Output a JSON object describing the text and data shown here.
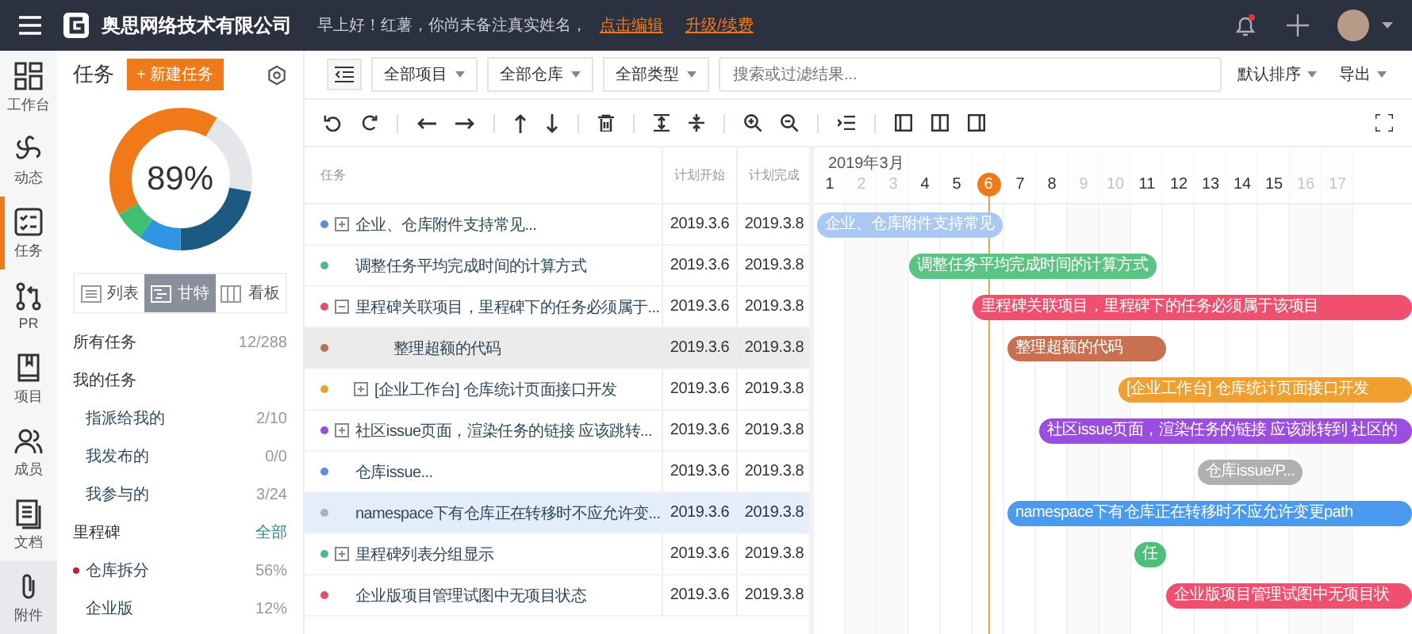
{
  "topbar": {
    "company": "奥思网络技术有限公司",
    "greeting": "早上好！红薯，你尚未备注真实姓名，",
    "edit_link": "点击编辑",
    "upgrade_link": "升级/续费",
    "has_notification": true
  },
  "rail": [
    {
      "label": "工作台",
      "selected": false
    },
    {
      "label": "动态",
      "selected": false
    },
    {
      "label": "任务",
      "selected": true
    },
    {
      "label": "PR",
      "selected": false
    },
    {
      "label": "项目",
      "selected": false
    },
    {
      "label": "成员",
      "selected": false
    },
    {
      "label": "文档",
      "selected": false
    },
    {
      "label": "附件",
      "selected": false
    }
  ],
  "sidebar": {
    "title": "任务",
    "new_button": "+ 新建任务",
    "progress": "89%",
    "views": [
      {
        "label": "列表",
        "selected": false
      },
      {
        "label": "甘特",
        "selected": true
      },
      {
        "label": "看板",
        "selected": false
      }
    ],
    "items": [
      {
        "kind": "row",
        "label": "所有任务",
        "count": "12/288"
      },
      {
        "kind": "header",
        "label": "我的任务"
      },
      {
        "kind": "sub",
        "label": "指派给我的",
        "count": "2/10"
      },
      {
        "kind": "sub",
        "label": "我发布的",
        "count": "0/0"
      },
      {
        "kind": "sub",
        "label": "我参与的",
        "count": "3/24"
      },
      {
        "kind": "header",
        "label": "里程碑",
        "link": "全部"
      },
      {
        "kind": "sub",
        "label": "仓库拆分",
        "count": "56%",
        "color": "#c0203a"
      },
      {
        "kind": "sub",
        "label": "企业版",
        "count": "12%"
      }
    ]
  },
  "filters": [
    "全部项目",
    "全部仓库",
    "全部类型"
  ],
  "search": {
    "placeholder": "搜索或过滤结果..."
  },
  "sort": "默认排序",
  "export": "导出",
  "table": {
    "columns": [
      "任务",
      "计划开始",
      "计划完成"
    ],
    "rows": [
      {
        "kind": "group",
        "expanded": false,
        "name": "企业、仓库附件支持常见...",
        "start": "2019.3.6",
        "end": "2019.3.8",
        "color": "#5b8fd6",
        "selected": false,
        "hovered": false
      },
      {
        "kind": "task",
        "name": "调整任务平均完成时间的计算方式",
        "start": "2019.3.6",
        "end": "2019.3.8",
        "color": "#4fb889",
        "selected": false,
        "hovered": false
      },
      {
        "kind": "group",
        "expanded": true,
        "name": "里程碑关联项目，里程碑下的任务必须属于...",
        "start": "2019.3.6",
        "end": "2019.3.8",
        "color": "#e0506a",
        "selected": false,
        "hovered": false,
        "children": [
          {
            "kind": "task",
            "name": "整理超额的代码",
            "start": "2019.3.6",
            "end": "2019.3.8",
            "color": "#b86f5a",
            "selected": true,
            "hovered": false
          },
          {
            "kind": "group",
            "expanded": false,
            "name": "[企业工作台] 仓库统计页面接口开发",
            "start": "2019.3.6",
            "end": "2019.3.8",
            "color": "#e0a830",
            "selected": false,
            "hovered": false
          }
        ]
      },
      {
        "kind": "group",
        "expanded": false,
        "name": "社区issue页面，渲染任务的链接 应该跳转...",
        "start": "2019.3.6",
        "end": "2019.3.8",
        "color": "#9b4de0",
        "selected": false,
        "hovered": false
      },
      {
        "kind": "task",
        "name": "仓库issue...",
        "start": "2019.3.6",
        "end": "2019.3.8",
        "color": "#5b8fd6",
        "selected": false,
        "hovered": false
      },
      {
        "kind": "task",
        "name": "namespace下有仓库正在转移时不应允许变...",
        "start": "2019.3.6",
        "end": "2019.3.8",
        "color": "#b0b0b0",
        "selected": false,
        "hovered": true
      },
      {
        "kind": "group",
        "expanded": false,
        "name": "里程碑列表分组显示",
        "start": "2019.3.6",
        "end": "2019.3.8",
        "color": "#4fb889",
        "selected": false,
        "hovered": false
      },
      {
        "kind": "task",
        "name": "企业版项目管理试图中无项目状态",
        "start": "2019.3.6",
        "end": "2019.3.8",
        "color": "#e0506a",
        "selected": false,
        "hovered": false
      }
    ]
  },
  "gantt": {
    "month": "2019年3月",
    "days": [
      {
        "label": "1",
        "weekend": false,
        "today": false
      },
      {
        "label": "2",
        "weekend": true,
        "today": false
      },
      {
        "label": "3",
        "weekend": true,
        "today": false
      },
      {
        "label": "4",
        "weekend": false,
        "today": false
      },
      {
        "label": "5",
        "weekend": false,
        "today": false
      },
      {
        "label": "6",
        "weekend": false,
        "today": true
      },
      {
        "label": "7",
        "weekend": false,
        "today": false
      },
      {
        "label": "8",
        "weekend": false,
        "today": false
      },
      {
        "label": "9",
        "weekend": true,
        "today": false
      },
      {
        "label": "10",
        "weekend": true,
        "today": false
      },
      {
        "label": "11",
        "weekend": false,
        "today": false
      },
      {
        "label": "12",
        "weekend": false,
        "today": false
      },
      {
        "label": "13",
        "weekend": false,
        "today": false
      },
      {
        "label": "14",
        "weekend": false,
        "today": false
      },
      {
        "label": "15",
        "weekend": false,
        "today": false
      },
      {
        "label": "16",
        "weekend": true,
        "today": false
      },
      {
        "label": "17",
        "weekend": true,
        "today": false
      }
    ],
    "bars": [
      {
        "label": "企业、仓库附件支持常见",
        "color": "#a9c9f2"
      },
      {
        "label": "调整任务平均完成时间的计算方式",
        "color": "#5cc483"
      },
      {
        "label": "里程碑关联项目，里程碑下的任务必须属于该项目",
        "color": "#f0506e"
      },
      {
        "label": "整理超额的代码",
        "color": "#c8704f"
      },
      {
        "label": "[企业工作台] 仓库统计页面接口开发",
        "color": "#f0a030"
      },
      {
        "label": "社区issue页面，渲染任务的链接 应该跳转到 社区的",
        "color": "#9b4de0"
      },
      {
        "label": "仓库issue/P...",
        "color": "#b0b0b0"
      },
      {
        "label": "namespace下有仓库正在转移时不应允许变更path",
        "color": "#4a9af0"
      },
      {
        "label": "任",
        "color": "#4cc07a"
      },
      {
        "label": "企业版项目管理试图中无项目状",
        "color": "#f0506e"
      }
    ]
  }
}
